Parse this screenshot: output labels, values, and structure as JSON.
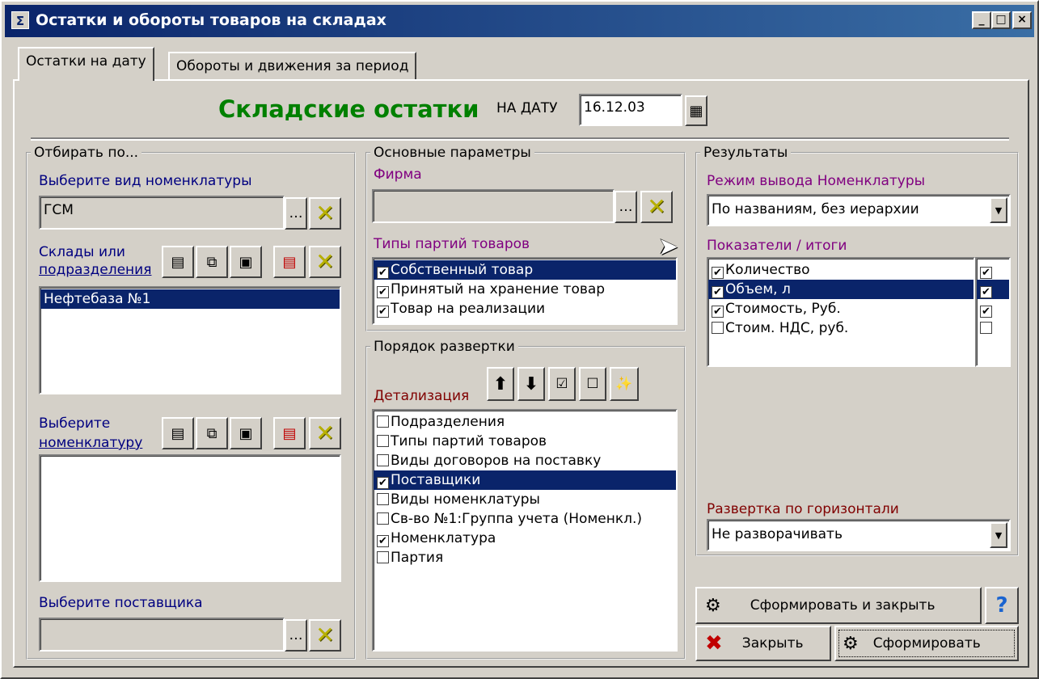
{
  "window": {
    "title": "Остатки и обороты товаров на складах",
    "min": "_",
    "max": "□",
    "close": "×"
  },
  "tabs": [
    {
      "label": "Остатки на дату"
    },
    {
      "label": "Обороты и движения за период"
    }
  ],
  "header": {
    "title": "Складские остатки",
    "date_label": "НА ДАТУ",
    "date_value": "16.12.03"
  },
  "filter": {
    "legend": "Отбирать по...",
    "nomen_type_label": "Выберите вид номенклатуры",
    "nomen_type_value": "ГСМ",
    "warehouses_label_1": "Склады или",
    "warehouses_label_2": "подразделения",
    "warehouses": [
      "Нефтебаза №1"
    ],
    "nomen_label_1": "Выберите",
    "nomen_label_2": "номенклатуру",
    "supplier_label": "Выберите поставщика",
    "supplier_value": ""
  },
  "main_params": {
    "legend": "Основные параметры",
    "firm_label": "Фирма",
    "firm_value": "",
    "batch_types_label": "Типы партий товаров",
    "batch_types": [
      {
        "label": "Собственный товар",
        "checked": true,
        "selected": true
      },
      {
        "label": "Принятый на хранение товар",
        "checked": true
      },
      {
        "label": "Товар на реализации",
        "checked": true
      }
    ]
  },
  "order": {
    "legend": "Порядок развертки",
    "detail_label": "Детализация",
    "items": [
      {
        "label": "Подразделения",
        "checked": false
      },
      {
        "label": "Типы партий товаров",
        "checked": false
      },
      {
        "label": "Виды договоров на поставку",
        "checked": false
      },
      {
        "label": "Поставщики",
        "checked": true,
        "selected": true
      },
      {
        "label": "Виды номенклатуры",
        "checked": false
      },
      {
        "label": "Св-во №1:Группа учета (Номенкл.)",
        "checked": false
      },
      {
        "label": "Номенклатура",
        "checked": true
      },
      {
        "label": "Партия",
        "checked": false
      }
    ]
  },
  "results": {
    "legend": "Результаты",
    "mode_label": "Режим вывода Номенклатуры",
    "mode_value": "По названиям, без иерархии",
    "indicators_label": "Показатели / итоги",
    "indicators": [
      {
        "label": "Количество",
        "checked": true,
        "total": true
      },
      {
        "label": "Объем, л",
        "checked": true,
        "total": true,
        "selected": true
      },
      {
        "label": "Стоимость, Руб.",
        "checked": true,
        "total": true
      },
      {
        "label": "Стоим. НДС, руб.",
        "checked": false,
        "total": false
      }
    ],
    "horizontal_label": "Развертка по горизонтали",
    "horizontal_value": "Не разворачивать"
  },
  "actions": {
    "generate_close": "Сформировать и закрыть",
    "close": "Закрыть",
    "generate": "Сформировать",
    "help": "?"
  },
  "colors": {
    "title_green": "#008000",
    "label_blue": "#000080",
    "label_purple": "#800080",
    "selection": "#0a246a"
  }
}
